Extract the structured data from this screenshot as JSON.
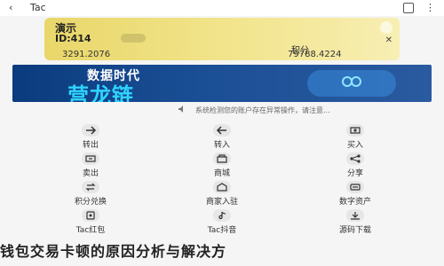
{
  "app": {
    "title": "Tac"
  },
  "wallet_card": {
    "wallet_name": "演示",
    "wallet_id": "ID:414",
    "left_value": "3291.2076",
    "right_label": "积分",
    "right_value": "79788.4224"
  },
  "banner": {
    "line1": "数据时代",
    "line2": "营龙链"
  },
  "notice": {
    "text": "系统检测您的账户存在异常操作，请注意..."
  },
  "grid": {
    "items": [
      {
        "label": "转出",
        "icon": "transfer-out-icon"
      },
      {
        "label": "转入",
        "icon": "transfer-in-icon"
      },
      {
        "label": "买入",
        "icon": "buy-icon"
      },
      {
        "label": "卖出",
        "icon": "sell-icon"
      },
      {
        "label": "商城",
        "icon": "shop-icon"
      },
      {
        "label": "分享",
        "icon": "share-icon"
      },
      {
        "label": "积分兑换",
        "icon": "points-exchange-icon"
      },
      {
        "label": "商家入驻",
        "icon": "merchant-join-icon"
      },
      {
        "label": "数字资产",
        "icon": "digital-assets-icon"
      },
      {
        "label": "Tac红包",
        "icon": "red-packet-icon"
      },
      {
        "label": "Tac抖音",
        "icon": "tiktok-icon"
      },
      {
        "label": "源码下载",
        "icon": "source-download-icon"
      }
    ]
  },
  "footer": {
    "title": "钱包交易卡顿的原因分析与解决方"
  },
  "colors": {
    "banner_bg": "#0a3b7e",
    "banner_accent": "#2fd4ff",
    "card_gold": "#e9d76a",
    "page_bg": "#f5f5f5"
  }
}
